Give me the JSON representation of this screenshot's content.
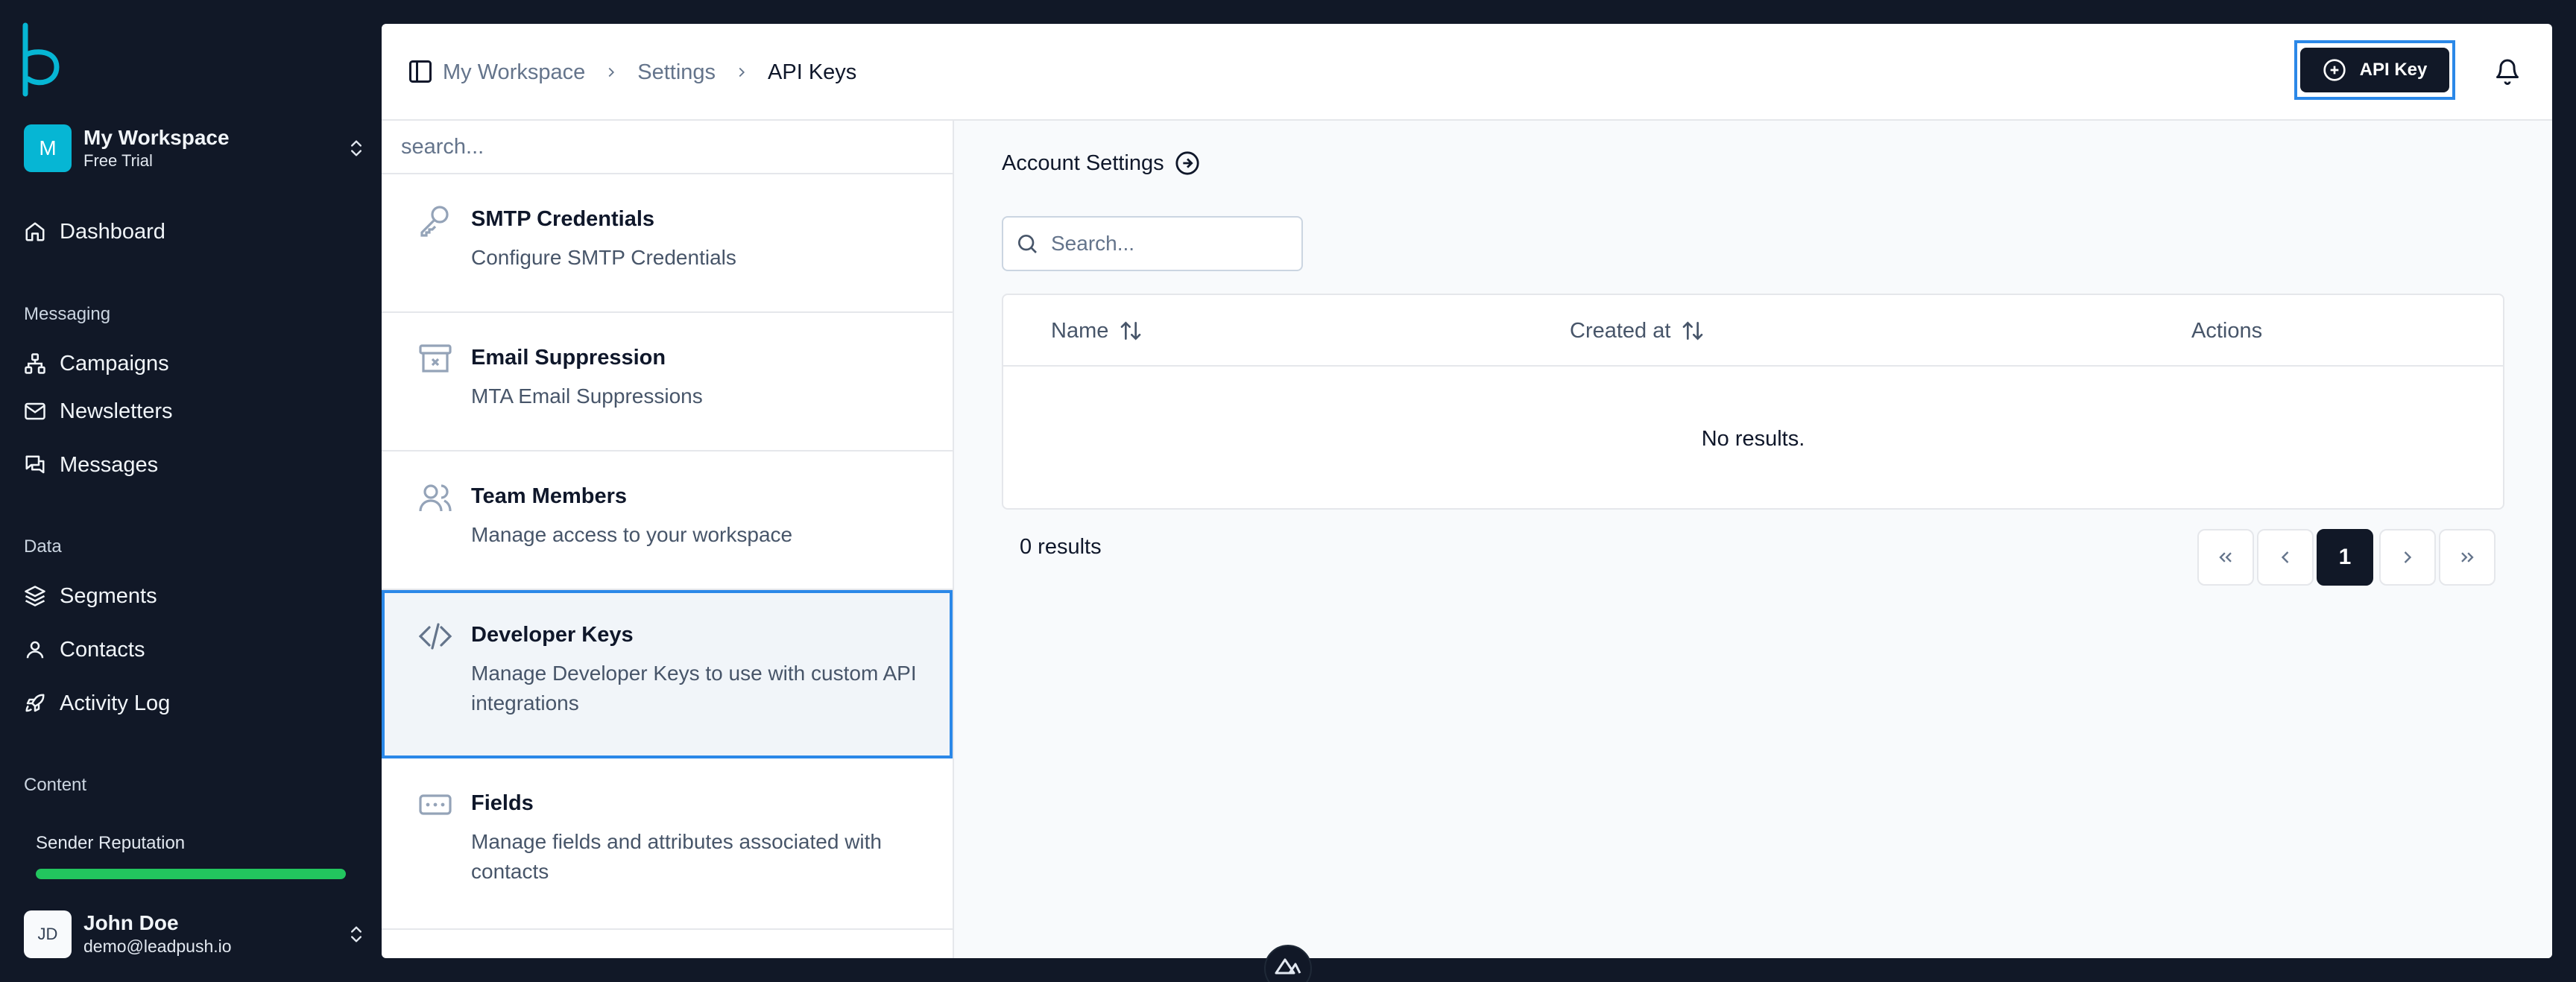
{
  "workspace": {
    "initial": "M",
    "name": "My Workspace",
    "plan": "Free Trial"
  },
  "nav": {
    "dashboard": "Dashboard",
    "messaging_heading": "Messaging",
    "campaigns": "Campaigns",
    "newsletters": "Newsletters",
    "messages": "Messages",
    "data_heading": "Data",
    "segments": "Segments",
    "contacts": "Contacts",
    "activity_log": "Activity Log",
    "content_heading": "Content"
  },
  "reputation": {
    "label": "Sender Reputation",
    "value": 1.0,
    "color": "#22c55e"
  },
  "user": {
    "initials": "JD",
    "name": "John Doe",
    "email": "demo@leadpush.io"
  },
  "breadcrumb": [
    "My Workspace",
    "Settings",
    "API Keys"
  ],
  "header": {
    "api_key_button": "API Key"
  },
  "settings_list": {
    "search_placeholder": "search...",
    "items": [
      {
        "title": "SMTP Credentials",
        "desc": "Configure SMTP Credentials",
        "icon": "key-icon"
      },
      {
        "title": "Email Suppression",
        "desc": "MTA Email Suppressions",
        "icon": "archive-x-icon"
      },
      {
        "title": "Team Members",
        "desc": "Manage access to your workspace",
        "icon": "users-icon"
      },
      {
        "title": "Developer Keys",
        "desc": "Manage Developer Keys to use with custom API integrations",
        "icon": "code-icon",
        "active": true
      },
      {
        "title": "Fields",
        "desc": "Manage fields and attributes associated with contacts",
        "icon": "input-field-icon"
      }
    ]
  },
  "content": {
    "section_title": "Account Settings",
    "search_placeholder": "Search...",
    "columns": [
      "Name",
      "Created at",
      "Actions"
    ],
    "empty_text": "No results.",
    "result_count": "0 results",
    "current_page": "1"
  },
  "colors": {
    "accent": "#2b88e8",
    "brand": "#06b6d4",
    "dark": "#111827"
  }
}
